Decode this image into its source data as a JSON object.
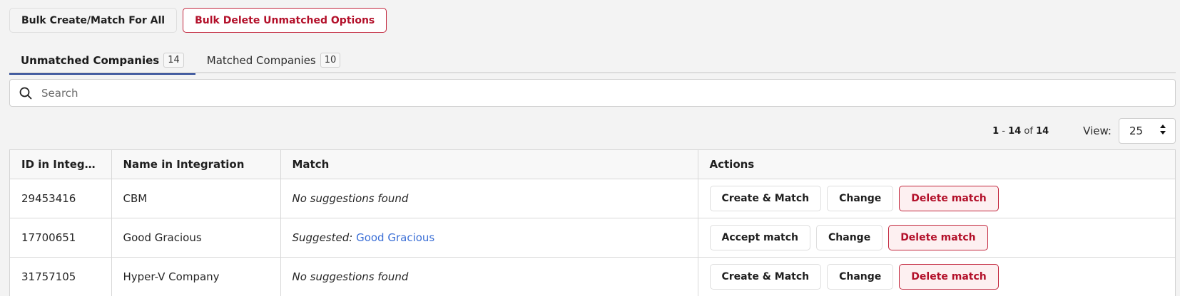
{
  "bulk": {
    "create_match_all": "Bulk Create/Match For All",
    "delete_unmatched": "Bulk Delete Unmatched Options"
  },
  "tabs": [
    {
      "label": "Unmatched Companies",
      "count": "14",
      "active": true
    },
    {
      "label": "Matched Companies",
      "count": "10",
      "active": false
    }
  ],
  "search": {
    "placeholder": "Search",
    "value": ""
  },
  "pager": {
    "start": "1",
    "dash": " - ",
    "end": "14",
    "of": " of ",
    "total": "14",
    "view_label": "View:",
    "view_value": "25"
  },
  "table": {
    "headers": {
      "id": "ID in Integrati...",
      "name": "Name in Integration",
      "match": "Match",
      "actions": "Actions"
    },
    "rows": [
      {
        "id": "29453416",
        "name": "CBM",
        "match_text": "No suggestions found",
        "match_prefix": "",
        "match_link": "",
        "primary_action": "Create & Match",
        "change": "Change",
        "delete": "Delete match"
      },
      {
        "id": "17700651",
        "name": "Good Gracious",
        "match_text": "",
        "match_prefix": "Suggested: ",
        "match_link": "Good Gracious",
        "primary_action": "Accept match",
        "change": "Change",
        "delete": "Delete match"
      },
      {
        "id": "31757105",
        "name": "Hyper-V Company",
        "match_text": "No suggestions found",
        "match_prefix": "",
        "match_link": "",
        "primary_action": "Create & Match",
        "change": "Change",
        "delete": "Delete match"
      }
    ]
  },
  "colors": {
    "accent": "#1d3c8f",
    "danger": "#b3102a",
    "link": "#3b6fd6"
  }
}
